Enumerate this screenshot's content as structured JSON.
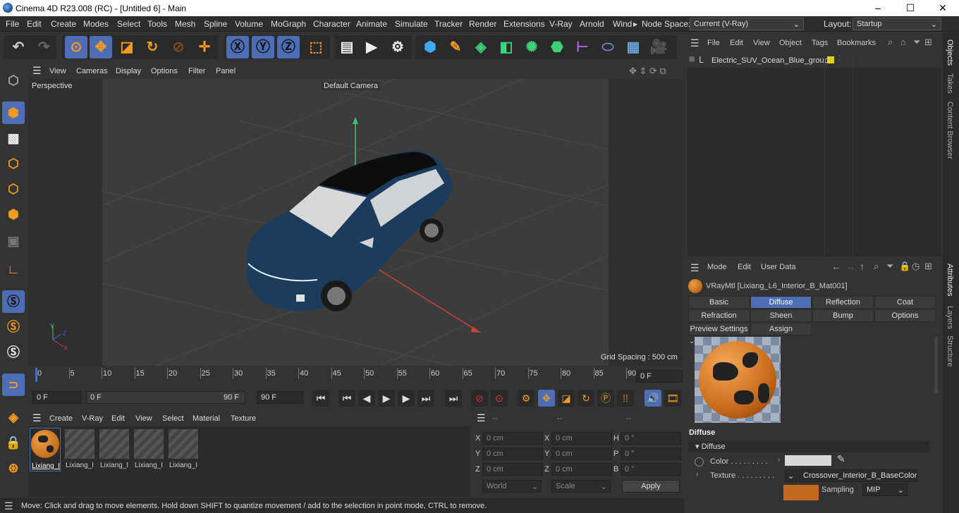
{
  "window": {
    "title": "Cinema 4D R23.008 (RC) - [Untitled 6] - Main",
    "minimize": "–",
    "maximize": "☐",
    "close": "✕"
  },
  "menu": {
    "items": [
      "File",
      "Edit",
      "Create",
      "Modes",
      "Select",
      "Tools",
      "Mesh",
      "Spline",
      "Volume",
      "MoGraph",
      "Character",
      "Animate",
      "Simulate",
      "Tracker",
      "Render",
      "Extensions",
      "V-Ray",
      "Arnold",
      "Wind"
    ],
    "more": "▸",
    "node_space_label": "Node Space:",
    "node_space_value": "Current (V-Ray)",
    "layout_label": "Layout:",
    "layout_value": "Startup"
  },
  "viewport": {
    "menu": [
      "View",
      "Cameras",
      "Display",
      "Options",
      "Filter",
      "Panel"
    ],
    "label": "Perspective",
    "camera": "Default Camera",
    "grid_spacing": "Grid Spacing : 500 cm",
    "axis_y": "Y",
    "axis_z": "Z",
    "axis_x": "X"
  },
  "timeline": {
    "ticks": [
      "0",
      "5",
      "10",
      "15",
      "20",
      "25",
      "30",
      "35",
      "40",
      "45",
      "50",
      "55",
      "60",
      "65",
      "70",
      "75",
      "80",
      "85",
      "90"
    ],
    "current_frame": "0 F",
    "start": "0 F",
    "range_start": "0 F",
    "range_end": "90 F",
    "end": "90 F"
  },
  "materials": {
    "menu": [
      "Create",
      "V-Ray",
      "Edit",
      "View",
      "Select",
      "Material",
      "Texture"
    ],
    "items": [
      "Lixiang_I",
      "Lixiang_I",
      "Lixiang_I",
      "Lixiang_I",
      "Lixiang_I"
    ]
  },
  "coords": {
    "header": [
      "--",
      "--",
      "--"
    ],
    "rows": [
      {
        "a": "X",
        "av": "0 cm",
        "b": "X",
        "bv": "0 cm",
        "c": "H",
        "cv": "0 °"
      },
      {
        "a": "Y",
        "av": "0 cm",
        "b": "Y",
        "bv": "0 cm",
        "c": "P",
        "cv": "0 °"
      },
      {
        "a": "Z",
        "av": "0 cm",
        "b": "Z",
        "bv": "0 cm",
        "c": "B",
        "cv": "0 °"
      }
    ],
    "world": "World",
    "scale": "Scale",
    "apply": "Apply"
  },
  "status": "Move: Click and drag to move elements. Hold down SHIFT to quantize movement / add to the selection in point mode, CTRL to remove.",
  "objects": {
    "menu": [
      "File",
      "Edit",
      "View",
      "Object",
      "Tags",
      "Bookmarks"
    ],
    "tree": [
      {
        "name": "Electric_SUV_Ocean_Blue_group"
      }
    ]
  },
  "attributes": {
    "menu": [
      "Mode",
      "Edit",
      "User Data"
    ],
    "title": "VRayMtl [Lixiang_L6_Interior_B_Mat001]",
    "tabs": [
      "Basic",
      "Diffuse",
      "Reflection",
      "Coat",
      "Refraction",
      "Sheen",
      "Bump",
      "Options",
      "Preview Settings",
      "Assign"
    ],
    "active_tab": "Diffuse",
    "section": "Diffuse",
    "group": "Diffuse",
    "color_label": "Color . . . . . . . . .",
    "texture_label": "Texture . . . . . . . . .",
    "texture_value": "Crossover_Interior_B_BaseColor.p",
    "sampling_label": "Sampling",
    "sampling_value": "MIP"
  },
  "side_tabs": [
    "Objects",
    "Takes",
    "Content Browser"
  ],
  "side_tabs2": [
    "Attributes",
    "Layers",
    "Structure"
  ],
  "colors": {
    "accent": "#4d6eb5",
    "orange": "#f29b22",
    "car": "#1c3c5e"
  }
}
